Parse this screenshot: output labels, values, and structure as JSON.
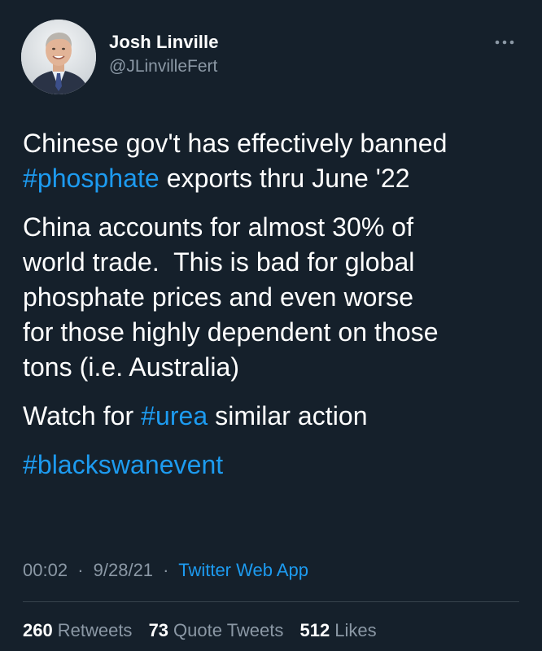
{
  "author": {
    "display_name": "Josh Linville",
    "handle": "@JLinvilleFert"
  },
  "menu": {
    "icon": "more-horizontal-icon"
  },
  "tweet": {
    "paragraphs": [
      [
        {
          "text": "Chinese gov't has effectively banned\n"
        },
        {
          "text": "#phosphate",
          "hashtag": true
        },
        {
          "text": " exports thru June '22"
        }
      ],
      [
        {
          "text": "China accounts for almost 30% of\nworld trade.  This is bad for global\nphosphate prices and even worse\nfor those highly dependent on those\ntons (i.e. Australia)"
        }
      ],
      [
        {
          "text": "Watch for "
        },
        {
          "text": "#urea",
          "hashtag": true
        },
        {
          "text": " similar action"
        }
      ],
      [
        {
          "text": "#blackswanevent",
          "hashtag": true
        }
      ]
    ]
  },
  "meta": {
    "time": "00:02",
    "date": "9/28/21",
    "separator": "·",
    "source": "Twitter Web App"
  },
  "stats": {
    "retweets_count": "260",
    "retweets_label": "Retweets",
    "quotes_count": "73",
    "quotes_label": "Quote Tweets",
    "likes_count": "512",
    "likes_label": "Likes"
  },
  "colors": {
    "background": "#15202b",
    "text": "#ffffff",
    "secondary_text": "#8b98a5",
    "link": "#1d9bf0",
    "divider": "#38444d"
  }
}
